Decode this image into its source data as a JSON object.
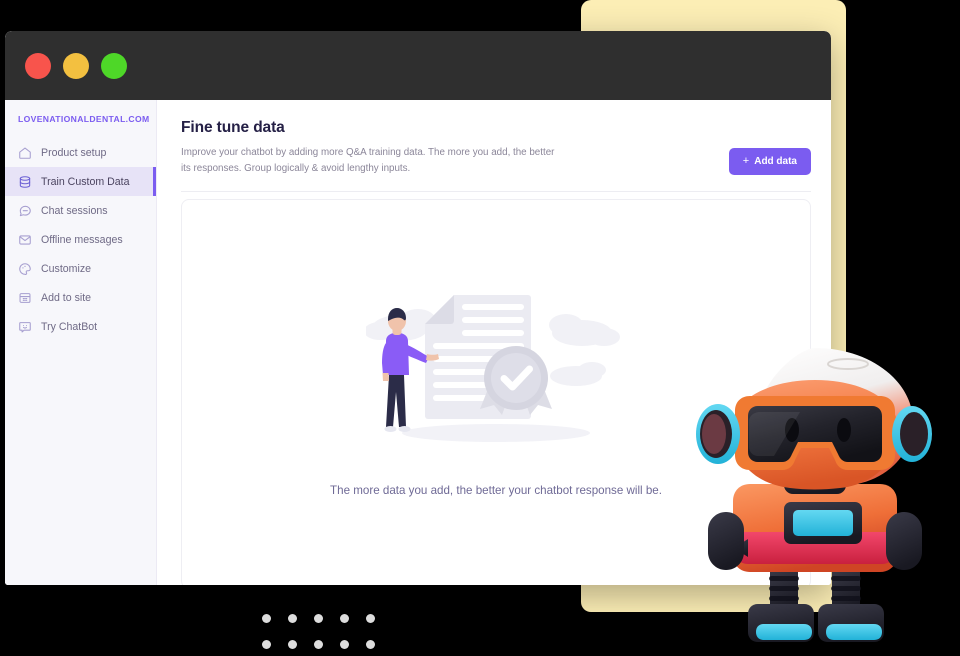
{
  "window": {
    "traffic_lights": [
      {
        "name": "close",
        "color": "#f8544c"
      },
      {
        "name": "minimize",
        "color": "#f3c040"
      },
      {
        "name": "maximize",
        "color": "#4ed728"
      }
    ]
  },
  "sidebar": {
    "brand": "LOVENATIONALDENTAL.COM",
    "items": [
      {
        "label": "Product setup",
        "icon": "home-icon",
        "active": false
      },
      {
        "label": "Train Custom Data",
        "icon": "database-icon",
        "active": true
      },
      {
        "label": "Chat sessions",
        "icon": "chat-icon",
        "active": false
      },
      {
        "label": "Offline messages",
        "icon": "envelope-icon",
        "active": false
      },
      {
        "label": "Customize",
        "icon": "palette-icon",
        "active": false
      },
      {
        "label": "Add to site",
        "icon": "grid-icon",
        "active": false
      },
      {
        "label": "Try ChatBot",
        "icon": "smiley-icon",
        "active": false
      }
    ]
  },
  "main": {
    "title": "Fine tune data",
    "subtitle": "Improve your chatbot by adding more Q&A training data. The more you add, the better its responses. Group logically & avoid lengthy inputs.",
    "add_button": {
      "label": "Add data",
      "plus": "+"
    },
    "empty_state": {
      "message": "The more data you add, the better your chatbot response will be.",
      "illustration": "person-document-award-illustration"
    }
  },
  "decorations": {
    "yellow_card_color": "#fceeb5",
    "accent_color": "#7b5cf0",
    "lavender_strip_color": "#d6c7f0",
    "dot_grid": {
      "rows": 2,
      "columns": 5,
      "dot_color": "#dddddd"
    },
    "mascot": "robot-mascot"
  }
}
